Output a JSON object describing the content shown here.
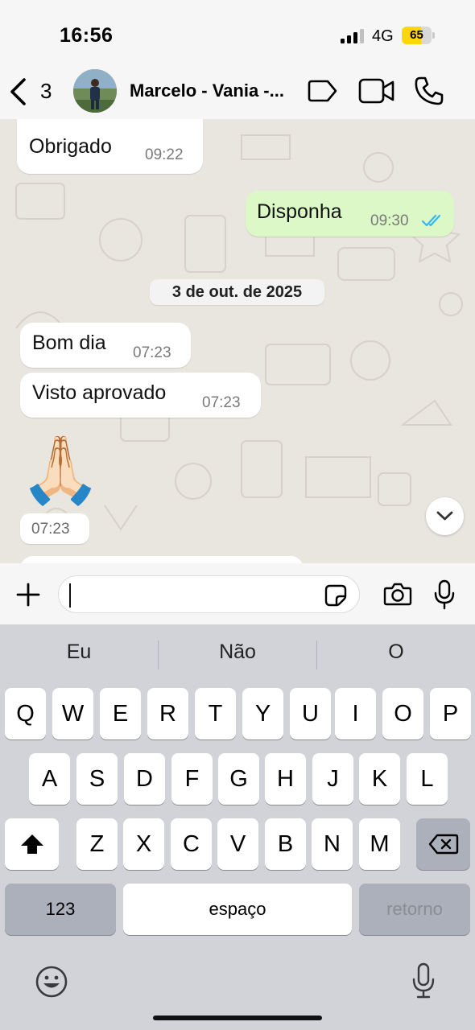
{
  "status_bar": {
    "time": "16:56",
    "network": "4G",
    "battery_level": "65",
    "battery_color": "#ffd60a"
  },
  "header": {
    "back_count": "3",
    "contact_name": "Marcelo - Vania -...",
    "icons": [
      "chevron-left-icon",
      "label-tag-icon",
      "video-call-icon",
      "phone-call-icon"
    ]
  },
  "messages": [
    {
      "direction": "in",
      "text": "Obrigado",
      "time": "09:22"
    },
    {
      "direction": "out",
      "text": "Disponha",
      "time": "09:30",
      "status": "read"
    },
    {
      "type": "date",
      "text": "3 de out. de 2025"
    },
    {
      "direction": "in",
      "text": "Bom dia",
      "time": "07:23"
    },
    {
      "direction": "in",
      "text": "Visto aprovado",
      "time": "07:23"
    },
    {
      "direction": "in",
      "emoji": "🙏🏻",
      "time": "07:23"
    }
  ],
  "composer": {
    "value": "",
    "icons": [
      "plus-icon",
      "sticker-icon",
      "camera-icon",
      "microphone-icon"
    ]
  },
  "keyboard": {
    "suggestions": [
      "Eu",
      "Não",
      "O"
    ],
    "row1": [
      "Q",
      "W",
      "E",
      "R",
      "T",
      "Y",
      "U",
      "I",
      "O",
      "P"
    ],
    "row2": [
      "A",
      "S",
      "D",
      "F",
      "G",
      "H",
      "J",
      "K",
      "L"
    ],
    "row3": [
      "Z",
      "X",
      "C",
      "V",
      "B",
      "N",
      "M"
    ],
    "numbers_label": "123",
    "space_label": "espaço",
    "return_label": "retorno"
  },
  "colors": {
    "outgoing_bubble": "#dcf8c6",
    "incoming_bubble": "#ffffff",
    "read_ticks": "#34b7f1"
  }
}
